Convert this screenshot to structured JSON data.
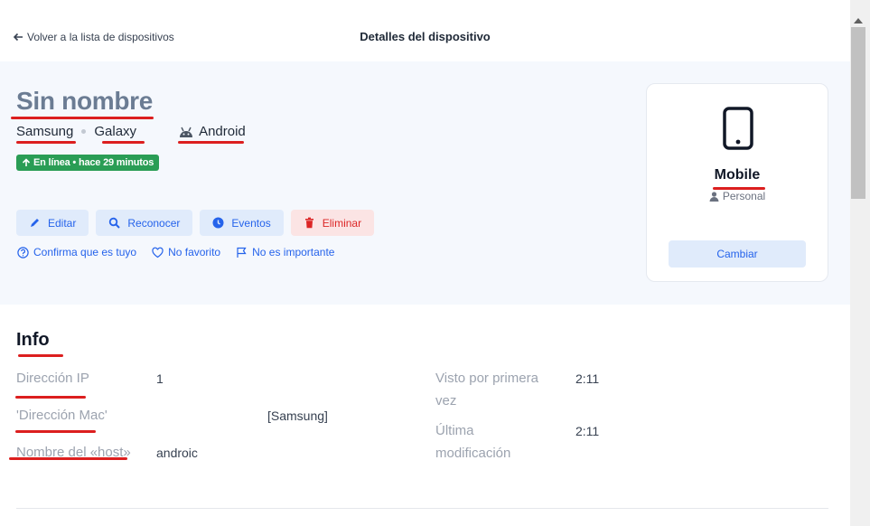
{
  "header": {
    "back_label": "Volver a la lista de dispositivos",
    "title": "Detalles del dispositivo"
  },
  "device": {
    "name": "Sin nombre",
    "manufacturer": "Samsung",
    "model": "Galaxy",
    "os": "Android",
    "status": "En línea • hace 29 minutos"
  },
  "actions": {
    "edit": "Editar",
    "recognize": "Reconocer",
    "events": "Eventos",
    "delete": "Eliminar"
  },
  "links": {
    "confirm": "Confirma que es tuyo",
    "favorite": "No favorito",
    "important": "No es importante"
  },
  "type_card": {
    "type": "Mobile",
    "owner": "Personal",
    "change": "Cambiar"
  },
  "info": {
    "title": "Info",
    "ip_label": "Dirección IP",
    "ip_value": "1",
    "mac_label": "'Dirección Mac'",
    "mac_value": "[Samsung]",
    "host_label": "Nombre del «host»",
    "host_value": "androic",
    "first_seen_label_1": "Visto por primera",
    "first_seen_label_2": "vez",
    "first_seen_value": "2:11",
    "modified_label_1": "Última",
    "modified_label_2": "modificación",
    "modified_value": "2:11"
  },
  "colors": {
    "accent": "#2563eb",
    "danger": "#dc2626",
    "online": "#2a9d55",
    "annotation": "#dc1f1f"
  }
}
